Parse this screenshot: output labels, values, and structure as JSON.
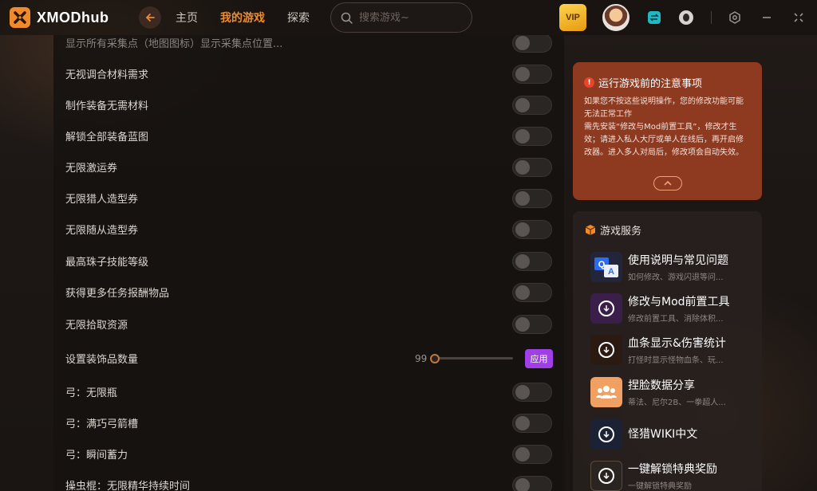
{
  "app": {
    "title": "XMODhub"
  },
  "nav": [
    {
      "label": "主页",
      "active": false
    },
    {
      "label": "我的游戏",
      "active": true
    },
    {
      "label": "探索",
      "active": false
    }
  ],
  "search": {
    "placeholder": "搜索游戏~"
  },
  "topbar": {
    "vip_label": "VIP"
  },
  "mods": {
    "partial_top_row": "显示所有采集点（地图图标）显示采集点位置...",
    "rows": [
      {
        "label": "无视调合材料需求",
        "enabled": false
      },
      {
        "label": "制作装备无需材料",
        "enabled": false
      },
      {
        "label": "解锁全部装备蓝图",
        "enabled": false
      },
      {
        "label": "无限激运券",
        "enabled": false
      },
      {
        "label": "无限猎人造型券",
        "enabled": false
      },
      {
        "label": "无限随从造型券",
        "enabled": false
      },
      {
        "label": "最高珠子技能等级",
        "enabled": false
      },
      {
        "label": "获得更多任务报酬物品",
        "enabled": false
      },
      {
        "label": "无限拾取资源",
        "enabled": false
      }
    ],
    "slider_row": {
      "label": "设置装饰品数量",
      "value": "99",
      "apply_label": "应用"
    },
    "rows_after": [
      {
        "label": "弓：无限瓶",
        "enabled": false
      },
      {
        "label": "弓：满巧弓箭槽",
        "enabled": false
      },
      {
        "label": "弓：瞬间蓄力",
        "enabled": false
      },
      {
        "label": "操虫棍：无限精华持续时间",
        "enabled": false
      }
    ]
  },
  "notice": {
    "title": "运行游戏前的注意事项",
    "lines": [
      "如果您不按这些说明操作，您的修改功能可能无法正常工作",
      "需先安装“修改与Mod前置工具”，修改才生效；请进入私人大厅或单人在线后，再开启修改器。进入多人对局后，修改项会自动失效。"
    ]
  },
  "services": {
    "title": "游戏服务",
    "items": [
      {
        "title": "使用说明与常见问题",
        "subtitle": "如何修改、游戏闪退等问...",
        "icon": "qa-icon",
        "color": "#2a2a3a"
      },
      {
        "title": "修改与Mod前置工具",
        "subtitle": "修改前置工具、消除体积...",
        "icon": "download-icon",
        "color": "#3a1f4a"
      },
      {
        "title": "血条显示&伤害统计",
        "subtitle": "打怪时显示怪物血条、玩...",
        "icon": "download-icon",
        "color": "#2a1a12"
      },
      {
        "title": "捏脸数据分享",
        "subtitle": "蒂法、尼尔2B、一拳超人...",
        "icon": "people-icon",
        "color": "#f0a060"
      },
      {
        "title": "怪猎WIKI中文",
        "subtitle": "",
        "icon": "download-icon",
        "color": "#1a2233"
      },
      {
        "title": "一键解锁特典奖励",
        "subtitle": "一键解锁特典奖励",
        "icon": "download-icon",
        "color": "#2a2420"
      }
    ]
  }
}
